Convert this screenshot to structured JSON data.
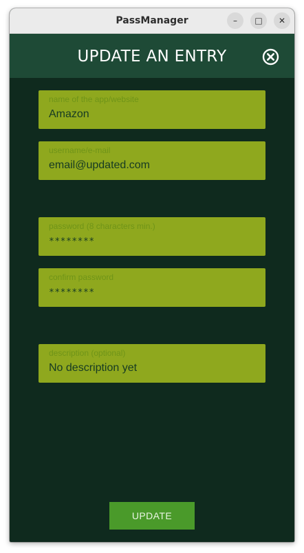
{
  "window": {
    "title": "PassManager",
    "minimize_glyph": "–",
    "maximize_glyph": "□",
    "close_glyph": "✕"
  },
  "header": {
    "title": "UPDATE AN ENTRY",
    "close_icon": "circle-x-icon"
  },
  "form": {
    "fields": [
      {
        "label": "name of the app/website",
        "value": "Amazon"
      },
      {
        "label": "username/e-mail",
        "value": "email@updated.com"
      },
      {
        "label": "password (8 characters min.)",
        "value": "********"
      },
      {
        "label": "confirm password",
        "value": "********"
      },
      {
        "label": "description (optional)",
        "value": "No description yet"
      }
    ],
    "submit_label": "UPDATE"
  },
  "colors": {
    "background": "#0f2a1e",
    "header": "#1e4a36",
    "field": "#8fa81e",
    "button": "#4a9a2a"
  }
}
